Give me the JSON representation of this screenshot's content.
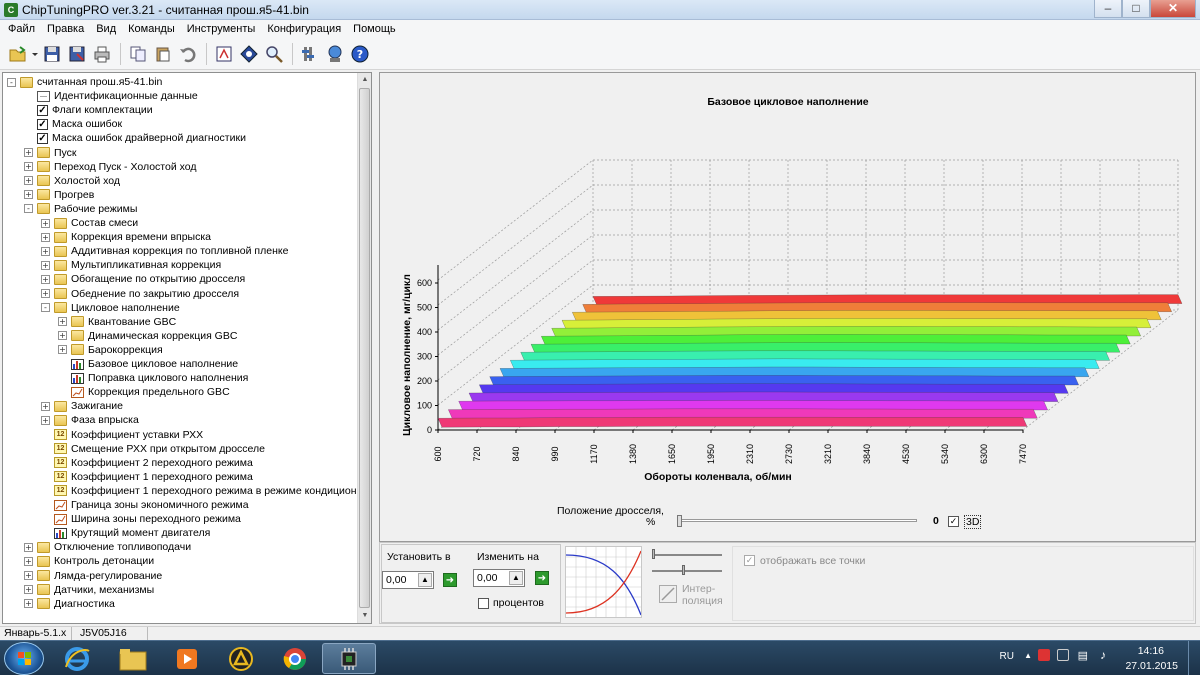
{
  "window": {
    "title": "ChipTuningPRO ver.3.21 - считанная прош.я5-41.bin"
  },
  "menu": [
    "Файл",
    "Правка",
    "Вид",
    "Команды",
    "Инструменты",
    "Конфигурация",
    "Помощь"
  ],
  "toolbar": [
    "open-icon",
    "save-icon",
    "save-as-icon",
    "print-icon",
    "copy-icon",
    "paste-icon",
    "undo-icon",
    "compare-icon",
    "checksum-icon",
    "search-icon",
    "settings-icon",
    "network-icon",
    "help-icon"
  ],
  "tree": [
    {
      "label": "считанная прош.я5-41.bin",
      "level": 0,
      "exp": "-",
      "icon": "folder-open-icon"
    },
    {
      "label": "Идентификационные данные",
      "level": 1,
      "exp": "",
      "icon": "id-data-icon"
    },
    {
      "label": "Флаги комплектации",
      "level": 1,
      "exp": "",
      "icon": "checkbox-icon"
    },
    {
      "label": "Маска ошибок",
      "level": 1,
      "exp": "",
      "icon": "checkbox-icon"
    },
    {
      "label": "Маска ошибок драйверной диагностики",
      "level": 1,
      "exp": "",
      "icon": "checkbox-icon"
    },
    {
      "label": "Пуск",
      "level": 1,
      "exp": "+",
      "icon": "folder-icon"
    },
    {
      "label": "Переход Пуск - Холостой ход",
      "level": 1,
      "exp": "+",
      "icon": "folder-icon"
    },
    {
      "label": "Холостой ход",
      "level": 1,
      "exp": "+",
      "icon": "folder-icon"
    },
    {
      "label": "Прогрев",
      "level": 1,
      "exp": "+",
      "icon": "folder-icon"
    },
    {
      "label": "Рабочие режимы",
      "level": 1,
      "exp": "-",
      "icon": "folder-open-icon"
    },
    {
      "label": "Состав смеси",
      "level": 2,
      "exp": "+",
      "icon": "folder-icon"
    },
    {
      "label": "Коррекция времени впрыска",
      "level": 2,
      "exp": "+",
      "icon": "folder-icon"
    },
    {
      "label": "Аддитивная коррекция по топливной пленке",
      "level": 2,
      "exp": "+",
      "icon": "folder-icon"
    },
    {
      "label": "Мультипликативная коррекция",
      "level": 2,
      "exp": "+",
      "icon": "folder-icon"
    },
    {
      "label": "Обогащение по открытию дросселя",
      "level": 2,
      "exp": "+",
      "icon": "folder-icon"
    },
    {
      "label": "Обеднение по закрытию дросселя",
      "level": 2,
      "exp": "+",
      "icon": "folder-icon"
    },
    {
      "label": "Цикловое наполнение",
      "level": 2,
      "exp": "-",
      "icon": "folder-open-icon"
    },
    {
      "label": "Квантование GBC",
      "level": 3,
      "exp": "+",
      "icon": "folder-icon"
    },
    {
      "label": "Динамическая коррекция GBC",
      "level": 3,
      "exp": "+",
      "icon": "folder-icon"
    },
    {
      "label": "Барокоррекция",
      "level": 3,
      "exp": "+",
      "icon": "folder-icon"
    },
    {
      "label": "Базовое цикловое наполнение",
      "level": 3,
      "exp": "",
      "icon": "bar-chart-icon"
    },
    {
      "label": "Поправка циклового наполнения",
      "level": 3,
      "exp": "",
      "icon": "bar-chart-icon"
    },
    {
      "label": "Коррекция предельного GBC",
      "level": 3,
      "exp": "",
      "icon": "line-graph-icon"
    },
    {
      "label": "Зажигание",
      "level": 2,
      "exp": "+",
      "icon": "folder-icon"
    },
    {
      "label": "Фаза впрыска",
      "level": 2,
      "exp": "+",
      "icon": "folder-icon"
    },
    {
      "label": "Коэффициент уставки РХХ",
      "level": 2,
      "exp": "",
      "icon": "number-icon"
    },
    {
      "label": "Смещение РХХ при открытом дросселе",
      "level": 2,
      "exp": "",
      "icon": "number-icon"
    },
    {
      "label": "Коэффициент 2 переходного режима",
      "level": 2,
      "exp": "",
      "icon": "number-icon"
    },
    {
      "label": "Коэффициент 1 переходного режима",
      "level": 2,
      "exp": "",
      "icon": "number-icon"
    },
    {
      "label": "Коэффициент 1 переходного режима в режиме кондиционирования",
      "level": 2,
      "exp": "",
      "icon": "number-icon"
    },
    {
      "label": "Граница зоны экономичного режима",
      "level": 2,
      "exp": "",
      "icon": "line-graph-icon"
    },
    {
      "label": "Ширина зоны переходного режима",
      "level": 2,
      "exp": "",
      "icon": "line-graph-icon"
    },
    {
      "label": "Крутящий момент двигателя",
      "level": 2,
      "exp": "",
      "icon": "bar-chart-icon"
    },
    {
      "label": "Отключение топливоподачи",
      "level": 1,
      "exp": "+",
      "icon": "folder-icon"
    },
    {
      "label": "Контроль детонации",
      "level": 1,
      "exp": "+",
      "icon": "folder-icon"
    },
    {
      "label": "Лямда-регулирование",
      "level": 1,
      "exp": "+",
      "icon": "folder-icon"
    },
    {
      "label": "Датчики, механизмы",
      "level": 1,
      "exp": "+",
      "icon": "folder-icon"
    },
    {
      "label": "Диагностика",
      "level": 1,
      "exp": "+",
      "icon": "folder-icon"
    }
  ],
  "chart_data": {
    "type": "surface3d",
    "title": "Базовое цикловое наполнение",
    "xlabel": "Обороты коленвала, об/мин",
    "ylabel": "Цикловое наполнение, мг/цикл",
    "x_categories": [
      "600",
      "720",
      "840",
      "990",
      "1170",
      "1380",
      "1650",
      "1950",
      "2310",
      "2730",
      "3210",
      "3840",
      "4530",
      "5340",
      "6300",
      "7470"
    ],
    "yticks": [
      "0",
      "100",
      "200",
      "300",
      "400",
      "500",
      "600"
    ],
    "ylim": [
      0,
      650
    ],
    "series_count": 16,
    "rows": [
      [
        95,
        100,
        100,
        110,
        110,
        115,
        120,
        120,
        120,
        120,
        120,
        115,
        115,
        115,
        115,
        115
      ],
      [
        140,
        145,
        145,
        150,
        150,
        155,
        160,
        160,
        160,
        160,
        155,
        155,
        150,
        150,
        150,
        150
      ],
      [
        180,
        185,
        185,
        190,
        190,
        195,
        195,
        200,
        200,
        195,
        195,
        190,
        190,
        185,
        185,
        185
      ],
      [
        215,
        220,
        220,
        225,
        230,
        235,
        235,
        240,
        240,
        235,
        235,
        230,
        230,
        225,
        225,
        225
      ],
      [
        250,
        255,
        260,
        265,
        270,
        275,
        275,
        280,
        275,
        275,
        270,
        270,
        265,
        265,
        265,
        260
      ],
      [
        285,
        290,
        295,
        300,
        305,
        310,
        315,
        315,
        315,
        310,
        310,
        305,
        305,
        300,
        300,
        300
      ],
      [
        320,
        325,
        330,
        335,
        340,
        345,
        350,
        355,
        355,
        350,
        345,
        345,
        340,
        340,
        335,
        335
      ],
      [
        355,
        360,
        365,
        370,
        375,
        380,
        385,
        390,
        385,
        385,
        380,
        380,
        375,
        375,
        370,
        370
      ],
      [
        385,
        390,
        395,
        400,
        410,
        415,
        420,
        420,
        420,
        415,
        415,
        410,
        410,
        405,
        405,
        405
      ],
      [
        415,
        420,
        425,
        430,
        440,
        445,
        450,
        455,
        455,
        450,
        450,
        445,
        445,
        440,
        440,
        440
      ],
      [
        445,
        450,
        455,
        465,
        470,
        480,
        485,
        490,
        490,
        485,
        485,
        480,
        480,
        475,
        475,
        475
      ],
      [
        475,
        480,
        490,
        495,
        505,
        510,
        515,
        520,
        520,
        520,
        515,
        515,
        510,
        510,
        505,
        505
      ],
      [
        505,
        510,
        520,
        525,
        535,
        540,
        545,
        550,
        550,
        550,
        545,
        545,
        540,
        540,
        540,
        540
      ],
      [
        535,
        540,
        545,
        555,
        560,
        570,
        575,
        580,
        580,
        580,
        575,
        575,
        575,
        570,
        570,
        570
      ],
      [
        560,
        570,
        575,
        580,
        590,
        595,
        600,
        605,
        605,
        605,
        605,
        600,
        600,
        600,
        600,
        600
      ],
      [
        590,
        595,
        600,
        610,
        615,
        620,
        625,
        630,
        630,
        630,
        630,
        630,
        630,
        630,
        635,
        635
      ]
    ],
    "grid": true,
    "colormap": "rainbow"
  },
  "throttle": {
    "label": "Положение дросселя,",
    "unit": "%",
    "value": "0",
    "checkbox_3d_label": "3D",
    "checkbox_3d_checked": true
  },
  "panel": {
    "set_label": "Установить в",
    "set_value": "0,00",
    "change_label": "Изменить на",
    "change_value": "0,00",
    "percent_label": "процентов",
    "interp_label": "Интер-\nполяция",
    "show_all_label": "отображать все точки"
  },
  "statusbar": [
    "Январь-5.1.x",
    "J5V05J16"
  ],
  "taskbar": {
    "lang": "RU",
    "time": "14:16",
    "date": "27.01.2015"
  }
}
